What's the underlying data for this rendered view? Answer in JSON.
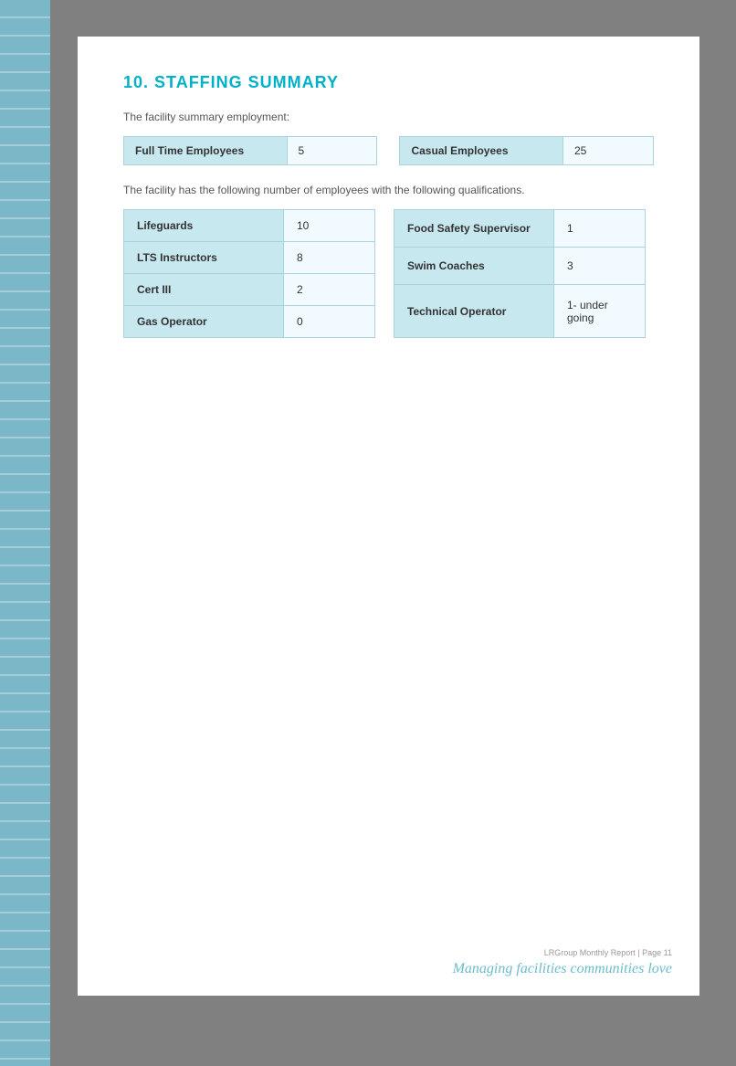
{
  "page": {
    "section_title": "10. STAFFING SUMMARY",
    "intro_employment": "The facility summary employment:",
    "intro_qualifications": "The facility has the following number of employees with the following qualifications.",
    "employment_summary": [
      {
        "label": "Full Time Employees",
        "value": "5"
      },
      {
        "label": "Casual Employees",
        "value": "25"
      }
    ],
    "qualifications_left": [
      {
        "label": "Lifeguards",
        "value": "10"
      },
      {
        "label": "LTS Instructors",
        "value": "8"
      },
      {
        "label": "Cert III",
        "value": "2"
      },
      {
        "label": "Gas Operator",
        "value": "0"
      }
    ],
    "qualifications_right": [
      {
        "label": "Food Safety Supervisor",
        "value": "1"
      },
      {
        "label": "Swim Coaches",
        "value": "3"
      },
      {
        "label": "Technical Operator",
        "value": "1- under going"
      }
    ],
    "footer": {
      "report_text": "LRGroup Monthly Report | Page 11",
      "tagline": "Managing facilities communities love"
    }
  }
}
